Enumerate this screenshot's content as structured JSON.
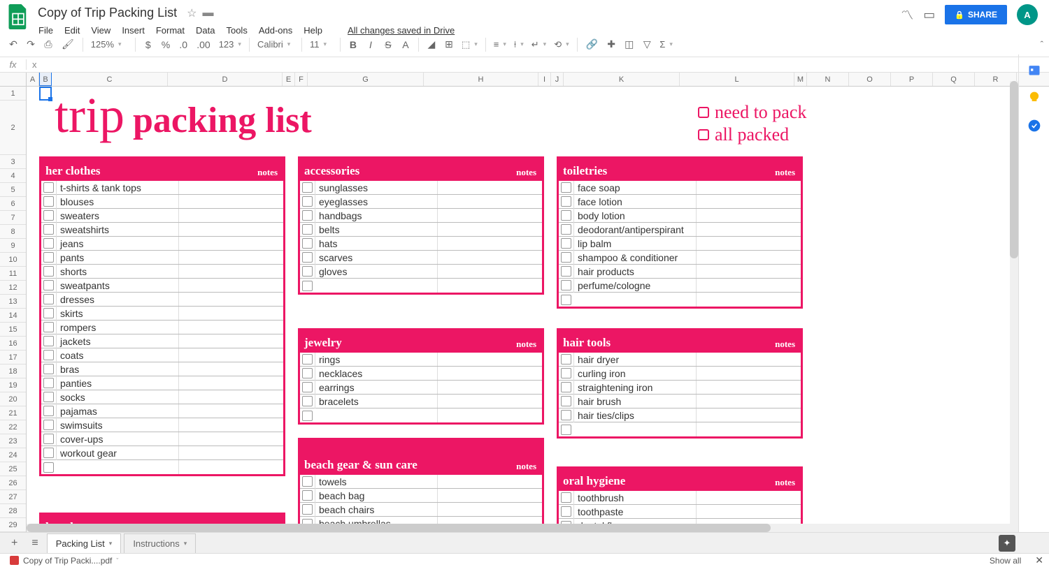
{
  "document": {
    "title": "Copy of Trip Packing List",
    "saved_message": "All changes saved in Drive",
    "share_button": "SHARE",
    "avatar_initial": "A",
    "active_cell_ref": "x"
  },
  "menu": {
    "file": "File",
    "edit": "Edit",
    "view": "View",
    "insert": "Insert",
    "format": "Format",
    "data": "Data",
    "tools": "Tools",
    "addons": "Add-ons",
    "help": "Help"
  },
  "toolbar": {
    "zoom": "125%",
    "currency": "$",
    "percent": "%",
    "dec_less": ".0",
    "dec_more": ".00",
    "format_more": "123",
    "font": "Calibri",
    "font_size": "11",
    "fx": "fx"
  },
  "columns": [
    "A",
    "B",
    "C",
    "D",
    "E",
    "F",
    "G",
    "H",
    "I",
    "J",
    "K",
    "L",
    "M",
    "N",
    "O",
    "P",
    "Q",
    "R"
  ],
  "rows": [
    "1",
    "2",
    "3",
    "4",
    "5",
    "6",
    "7",
    "8",
    "9",
    "10",
    "11",
    "12",
    "13",
    "14",
    "15",
    "16",
    "17",
    "18",
    "19",
    "20",
    "21",
    "22",
    "23",
    "24",
    "25",
    "26",
    "27",
    "28",
    "29"
  ],
  "title_block": {
    "trip": "trip",
    "packing": "packing list",
    "legend1": "need to pack",
    "legend2": "all packed"
  },
  "notes_label": "notes",
  "categories": {
    "her_clothes": {
      "title": "her clothes",
      "items": [
        "t-shirts & tank tops",
        "blouses",
        "sweaters",
        "sweatshirts",
        "jeans",
        "pants",
        "shorts",
        "sweatpants",
        "dresses",
        "skirts",
        "rompers",
        "jackets",
        "coats",
        "bras",
        "panties",
        "socks",
        "pajamas",
        "swimsuits",
        "cover-ups",
        "workout gear",
        ""
      ]
    },
    "accessories": {
      "title": "accessories",
      "items": [
        "sunglasses",
        "eyeglasses",
        "handbags",
        "belts",
        "hats",
        "scarves",
        "gloves",
        ""
      ]
    },
    "toiletries": {
      "title": "toiletries",
      "items": [
        "face soap",
        "face lotion",
        "body lotion",
        "deodorant/antiperspirant",
        "lip balm",
        "shampoo & conditioner",
        "hair products",
        "perfume/cologne",
        ""
      ]
    },
    "jewelry": {
      "title": "jewelry",
      "items": [
        "rings",
        "necklaces",
        "earrings",
        "bracelets",
        ""
      ]
    },
    "hair_tools": {
      "title": "hair tools",
      "items": [
        "hair dryer",
        "curling iron",
        "straightening iron",
        "hair brush",
        "hair ties/clips",
        ""
      ]
    },
    "beach": {
      "title": "beach gear & sun care",
      "items": [
        "towels",
        "beach bag",
        "beach chairs",
        "beach umbrellas"
      ]
    },
    "oral": {
      "title": "oral hygiene",
      "items": [
        "toothbrush",
        "toothpaste",
        "dental floss"
      ]
    },
    "her_shoes": {
      "title": "her shoes",
      "items": []
    }
  },
  "tabs": {
    "active": "Packing List",
    "other": "Instructions"
  },
  "download": {
    "file": "Copy of Trip Packi....pdf",
    "showall": "Show all"
  }
}
